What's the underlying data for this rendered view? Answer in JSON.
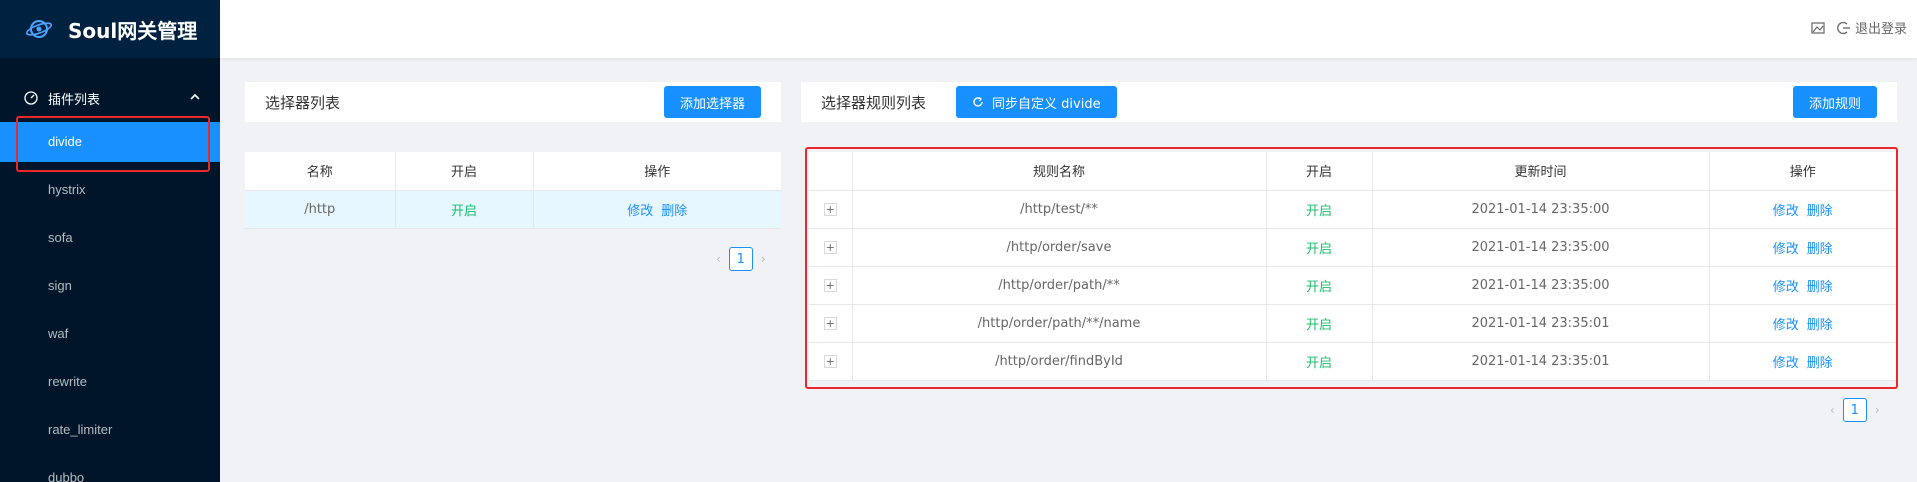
{
  "app": {
    "title": "Soul网关管理"
  },
  "sidebar": {
    "group_label": "插件列表",
    "items": [
      {
        "label": "divide"
      },
      {
        "label": "hystrix"
      },
      {
        "label": "sofa"
      },
      {
        "label": "sign"
      },
      {
        "label": "waf"
      },
      {
        "label": "rewrite"
      },
      {
        "label": "rate_limiter"
      },
      {
        "label": "dubbo"
      }
    ]
  },
  "header": {
    "logout_label": "退出登录"
  },
  "selector_panel": {
    "title": "选择器列表",
    "add_button": "添加选择器",
    "columns": [
      "名称",
      "开启",
      "操作"
    ],
    "rows": [
      {
        "name": "/http",
        "enabled": "开启",
        "edit": "修改",
        "delete": "删除"
      }
    ],
    "page": "1"
  },
  "rule_panel": {
    "title": "选择器规则列表",
    "sync_button": "同步自定义 divide",
    "add_button": "添加规则",
    "columns": [
      "",
      "规则名称",
      "开启",
      "更新时间",
      "操作"
    ],
    "rows": [
      {
        "expand": "+",
        "name": "/http/test/**",
        "enabled": "开启",
        "updated": "2021-01-14 23:35:00",
        "edit": "修改",
        "delete": "删除"
      },
      {
        "expand": "+",
        "name": "/http/order/save",
        "enabled": "开启",
        "updated": "2021-01-14 23:35:00",
        "edit": "修改",
        "delete": "删除"
      },
      {
        "expand": "+",
        "name": "/http/order/path/**",
        "enabled": "开启",
        "updated": "2021-01-14 23:35:00",
        "edit": "修改",
        "delete": "删除"
      },
      {
        "expand": "+",
        "name": "/http/order/path/**/name",
        "enabled": "开启",
        "updated": "2021-01-14 23:35:01",
        "edit": "修改",
        "delete": "删除"
      },
      {
        "expand": "+",
        "name": "/http/order/findById",
        "enabled": "开启",
        "updated": "2021-01-14 23:35:01",
        "edit": "修改",
        "delete": "删除"
      }
    ],
    "page": "1"
  },
  "colors": {
    "primary": "#1890ff",
    "sidebar_bg": "#001529",
    "enabled_green": "#19be6b",
    "highlight_red": "#e8282c"
  }
}
